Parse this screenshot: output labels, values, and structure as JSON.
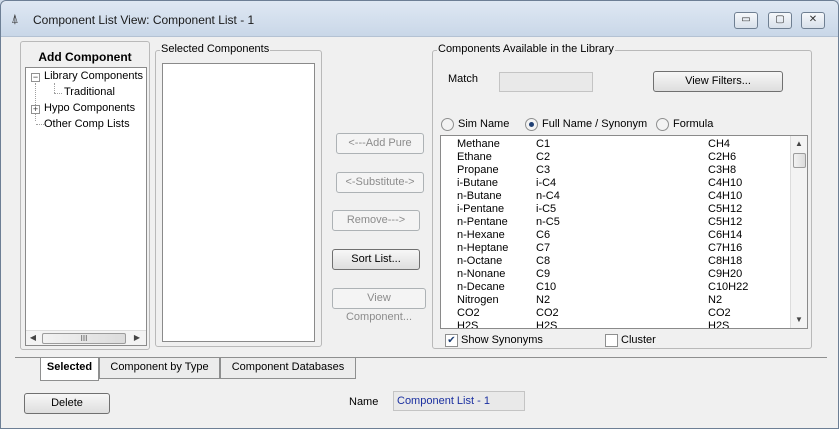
{
  "window": {
    "title": "Component List View: Component List - 1",
    "title_icon": "flask-icon",
    "minimize_glyph": "▭",
    "maximize_glyph": "▢",
    "close_glyph": "✕"
  },
  "add_component": {
    "title": "Add Component",
    "tree": [
      {
        "label": "Library Components",
        "expander": "−"
      },
      {
        "label": "Traditional",
        "expander": ""
      },
      {
        "label": "Hypo Components",
        "expander": "+"
      },
      {
        "label": "Other Comp Lists",
        "expander": ""
      }
    ],
    "hscroll_grip": "III"
  },
  "selected_components": {
    "label": "Selected Components"
  },
  "actions": {
    "add_pure": "<---Add Pure",
    "substitute": "<-Substitute->",
    "remove": "Remove--->",
    "sort_list": "Sort List...",
    "view_component": "View Component..."
  },
  "library": {
    "label": "Components Available in the Library",
    "match_label": "Match",
    "match_value": "",
    "view_filters": "View Filters...",
    "radio_options": [
      {
        "label": "Sim Name",
        "selected": false
      },
      {
        "label": "Full Name / Synonym",
        "selected": true
      },
      {
        "label": "Formula",
        "selected": false
      }
    ],
    "rows": [
      [
        "Methane",
        "C1",
        "CH4"
      ],
      [
        "Ethane",
        "C2",
        "C2H6"
      ],
      [
        "Propane",
        "C3",
        "C3H8"
      ],
      [
        "i-Butane",
        "i-C4",
        "C4H10"
      ],
      [
        "n-Butane",
        "n-C4",
        "C4H10"
      ],
      [
        "i-Pentane",
        "i-C5",
        "C5H12"
      ],
      [
        "n-Pentane",
        "n-C5",
        "C5H12"
      ],
      [
        "n-Hexane",
        "C6",
        "C6H14"
      ],
      [
        "n-Heptane",
        "C7",
        "C7H16"
      ],
      [
        "n-Octane",
        "C8",
        "C8H18"
      ],
      [
        "n-Nonane",
        "C9",
        "C9H20"
      ],
      [
        "n-Decane",
        "C10",
        "C10H22"
      ],
      [
        "Nitrogen",
        "N2",
        "N2"
      ],
      [
        "CO2",
        "CO2",
        "CO2"
      ],
      [
        "H2S",
        "H2S",
        "H2S"
      ]
    ],
    "show_synonyms": {
      "label": "Show Synonyms",
      "checked": true
    },
    "cluster": {
      "label": "Cluster",
      "checked": false
    }
  },
  "tabs": [
    "Selected",
    "Component by Type",
    "Component Databases"
  ],
  "footer": {
    "delete": "Delete",
    "name_label": "Name",
    "name_value": "Component List - 1"
  },
  "colors": {
    "name_text": "#1a2fa0",
    "title_bar": "#d4e0ee"
  }
}
